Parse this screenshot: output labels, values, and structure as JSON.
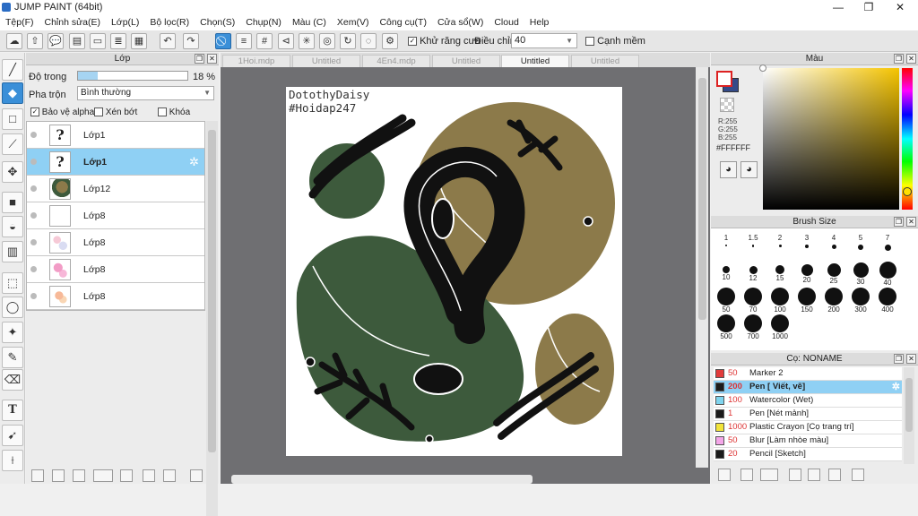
{
  "app": {
    "title": "JUMP PAINT (64bit)"
  },
  "window_controls": {
    "minimize": "—",
    "maximize": "❐",
    "close": "✕"
  },
  "menu": [
    "Tệp(F)",
    "Chỉnh sửa(E)",
    "Lớp(L)",
    "Bộ lọc(R)",
    "Chọn(S)",
    "Chụp(N)",
    "Màu (C)",
    "Xem(V)",
    "Công cụ(T)",
    "Cửa sổ(W)",
    "Cloud",
    "Help"
  ],
  "toolbar": {
    "antialias_label": "Khử răng cưa",
    "adjust_label": "Điều chỉnh",
    "adjust_value": "40",
    "smooth_label": "Cạnh mềm"
  },
  "layer_panel": {
    "title": "Lớp",
    "opacity_label": "Độ trong",
    "opacity_value": "18 %",
    "opacity_fraction": 0.18,
    "blend_label": "Pha trộn",
    "blend_value": "Bình thường",
    "protect_alpha": "Bảo vệ alpha",
    "clip": "Xén bớt",
    "lock": "Khóa",
    "layers": [
      {
        "name": "Lớp1",
        "thumb": "?",
        "selected": false
      },
      {
        "name": "Lớp1",
        "thumb": "?",
        "selected": true
      },
      {
        "name": "Lớp12",
        "thumb": "",
        "selected": false
      },
      {
        "name": "Lớp8",
        "thumb": "",
        "selected": false
      },
      {
        "name": "Lớp8",
        "thumb": "",
        "selected": false
      },
      {
        "name": "Lớp8",
        "thumb": "",
        "selected": false
      },
      {
        "name": "Lớp8",
        "thumb": "",
        "selected": false
      }
    ]
  },
  "tabs": [
    {
      "label": "1Hoi.mdp",
      "active": false
    },
    {
      "label": "Untitled",
      "active": false
    },
    {
      "label": "4En4.mdp",
      "active": false
    },
    {
      "label": "Untitled",
      "active": false
    },
    {
      "label": "Untitled",
      "active": true
    },
    {
      "label": "Untitled",
      "active": false
    }
  ],
  "canvas": {
    "watermark_1": "DotothyDaisy",
    "watermark_2": "#Hoidap247"
  },
  "color_panel": {
    "title": "Màu",
    "r": "R:255",
    "g": "G:255",
    "b": "B:255",
    "hex": "#FFFFFF"
  },
  "brush_size_panel": {
    "title": "Brush Size",
    "sizes": [
      "1",
      "1.5",
      "2",
      "3",
      "4",
      "5",
      "7",
      "10",
      "12",
      "15",
      "20",
      "25",
      "30",
      "40",
      "50",
      "70",
      "100",
      "150",
      "200",
      "300",
      "400",
      "500",
      "700",
      "1000"
    ]
  },
  "brush_panel": {
    "title": "Cọ: NONAME",
    "brushes": [
      {
        "size": "50",
        "name": "Marker 2",
        "color": "#e23b3b",
        "selected": false
      },
      {
        "size": "200",
        "name": "Pen [ Viết, vẽ]",
        "color": "#1b1b1b",
        "selected": true
      },
      {
        "size": "100",
        "name": "Watercolor (Wet)",
        "color": "#7fd4ee",
        "selected": false
      },
      {
        "size": "1",
        "name": "Pen [Nét mảnh]",
        "color": "#1b1b1b",
        "selected": false
      },
      {
        "size": "1000",
        "name": "Plastic Crayon [Cọ trang trí]",
        "color": "#f2e43a",
        "selected": false
      },
      {
        "size": "50",
        "name": "Blur [Làm nhòe màu]",
        "color": "#f4a6e8",
        "selected": false
      },
      {
        "size": "20",
        "name": "Pencil [Sketch]",
        "color": "#1b1b1b",
        "selected": false
      }
    ]
  },
  "colors": {
    "accent": "#3a8fd8",
    "selected_row": "#8fd0f4",
    "olive": "#8c7a4a",
    "dark_green": "#3d5a3c",
    "canvas_bg": "#6f6f72"
  }
}
